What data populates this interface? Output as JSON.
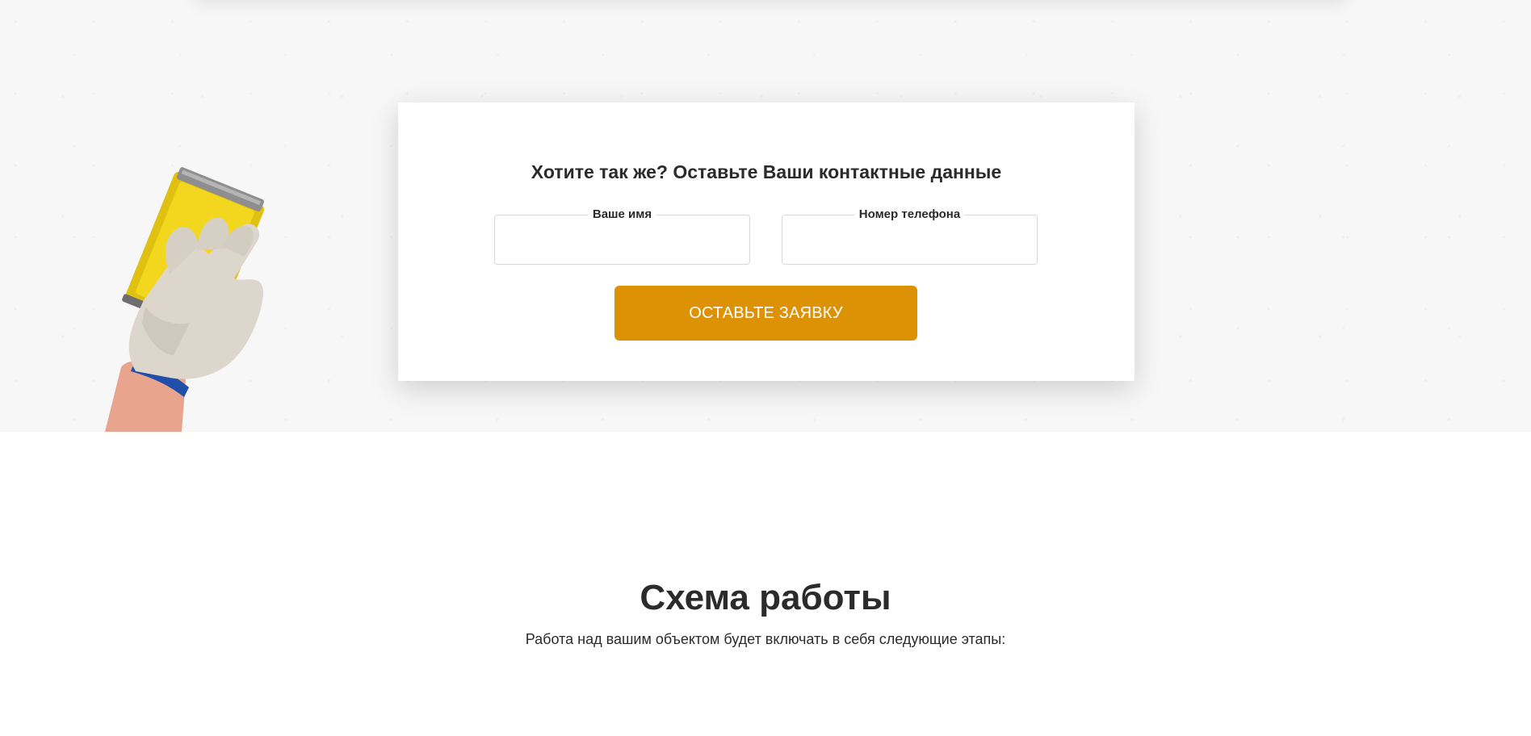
{
  "request_form": {
    "title": "Хотите так же? Оставьте Ваши контактные данные",
    "name_field": {
      "label": "Ваше имя",
      "value": "",
      "placeholder": ""
    },
    "phone_field": {
      "label": "Номер телефона",
      "value": "",
      "placeholder": ""
    },
    "submit_label": "ОСТАВЬТЕ ЗАЯВКУ",
    "accent_color": "#dd9104"
  },
  "hero": {
    "illustration": "hand-sanding-wall-image"
  },
  "work_scheme": {
    "title": "Схема работы",
    "subtitle": "Работа над вашим объектом будет включать в себя следующие этапы:"
  }
}
